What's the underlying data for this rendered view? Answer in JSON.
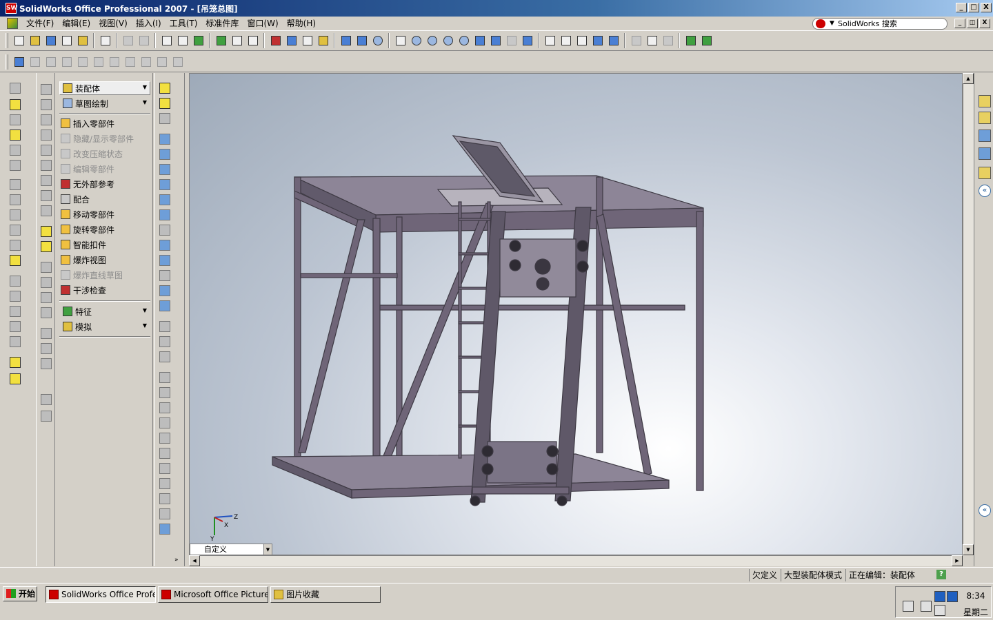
{
  "window": {
    "title": "SolidWorks Office Professional 2007 - [吊笼总图]",
    "minimize": "_",
    "maximize": "□",
    "close": "X"
  },
  "menu": {
    "items": [
      "文件(F)",
      "编辑(E)",
      "视图(V)",
      "插入(I)",
      "工具(T)",
      "标准件库",
      "窗口(W)",
      "帮助(H)"
    ],
    "search_text": "SolidWorks 搜索"
  },
  "command_manager": {
    "active_tab": "装配体",
    "sketch_tab": "草图绘制",
    "items": [
      {
        "label": "插入零部件",
        "enabled": true
      },
      {
        "label": "隐藏/显示零部件",
        "enabled": false
      },
      {
        "label": "改变压缩状态",
        "enabled": false
      },
      {
        "label": "编辑零部件",
        "enabled": false
      },
      {
        "label": "无外部参考",
        "enabled": true
      },
      {
        "label": "配合",
        "enabled": true
      },
      {
        "label": "移动零部件",
        "enabled": true
      },
      {
        "label": "旋转零部件",
        "enabled": true
      },
      {
        "label": "智能扣件",
        "enabled": true
      },
      {
        "label": "爆炸视图",
        "enabled": true
      },
      {
        "label": "爆炸直线草图",
        "enabled": false
      },
      {
        "label": "干涉检查",
        "enabled": true
      }
    ],
    "features_tab": "特征",
    "simulation_tab": "模拟"
  },
  "viewport": {
    "view_orientation": "自定义",
    "background_color": "#bcc5d2",
    "model_color": "#6f6578",
    "axis_labels": {
      "x": "X",
      "y": "Y",
      "z": "Z"
    }
  },
  "status": {
    "underdefined": "欠定义",
    "large_assembly": "大型装配体模式",
    "editing": "正在编辑：装配体",
    "help": "?"
  },
  "taskbar": {
    "start": "开始",
    "tasks": [
      {
        "label": "SolidWorks Office Profes...",
        "active": true
      },
      {
        "label": "Microsoft Office Picture ...",
        "active": false
      },
      {
        "label": "图片收藏",
        "active": false
      }
    ],
    "time": "8:34",
    "day": "星期二"
  }
}
